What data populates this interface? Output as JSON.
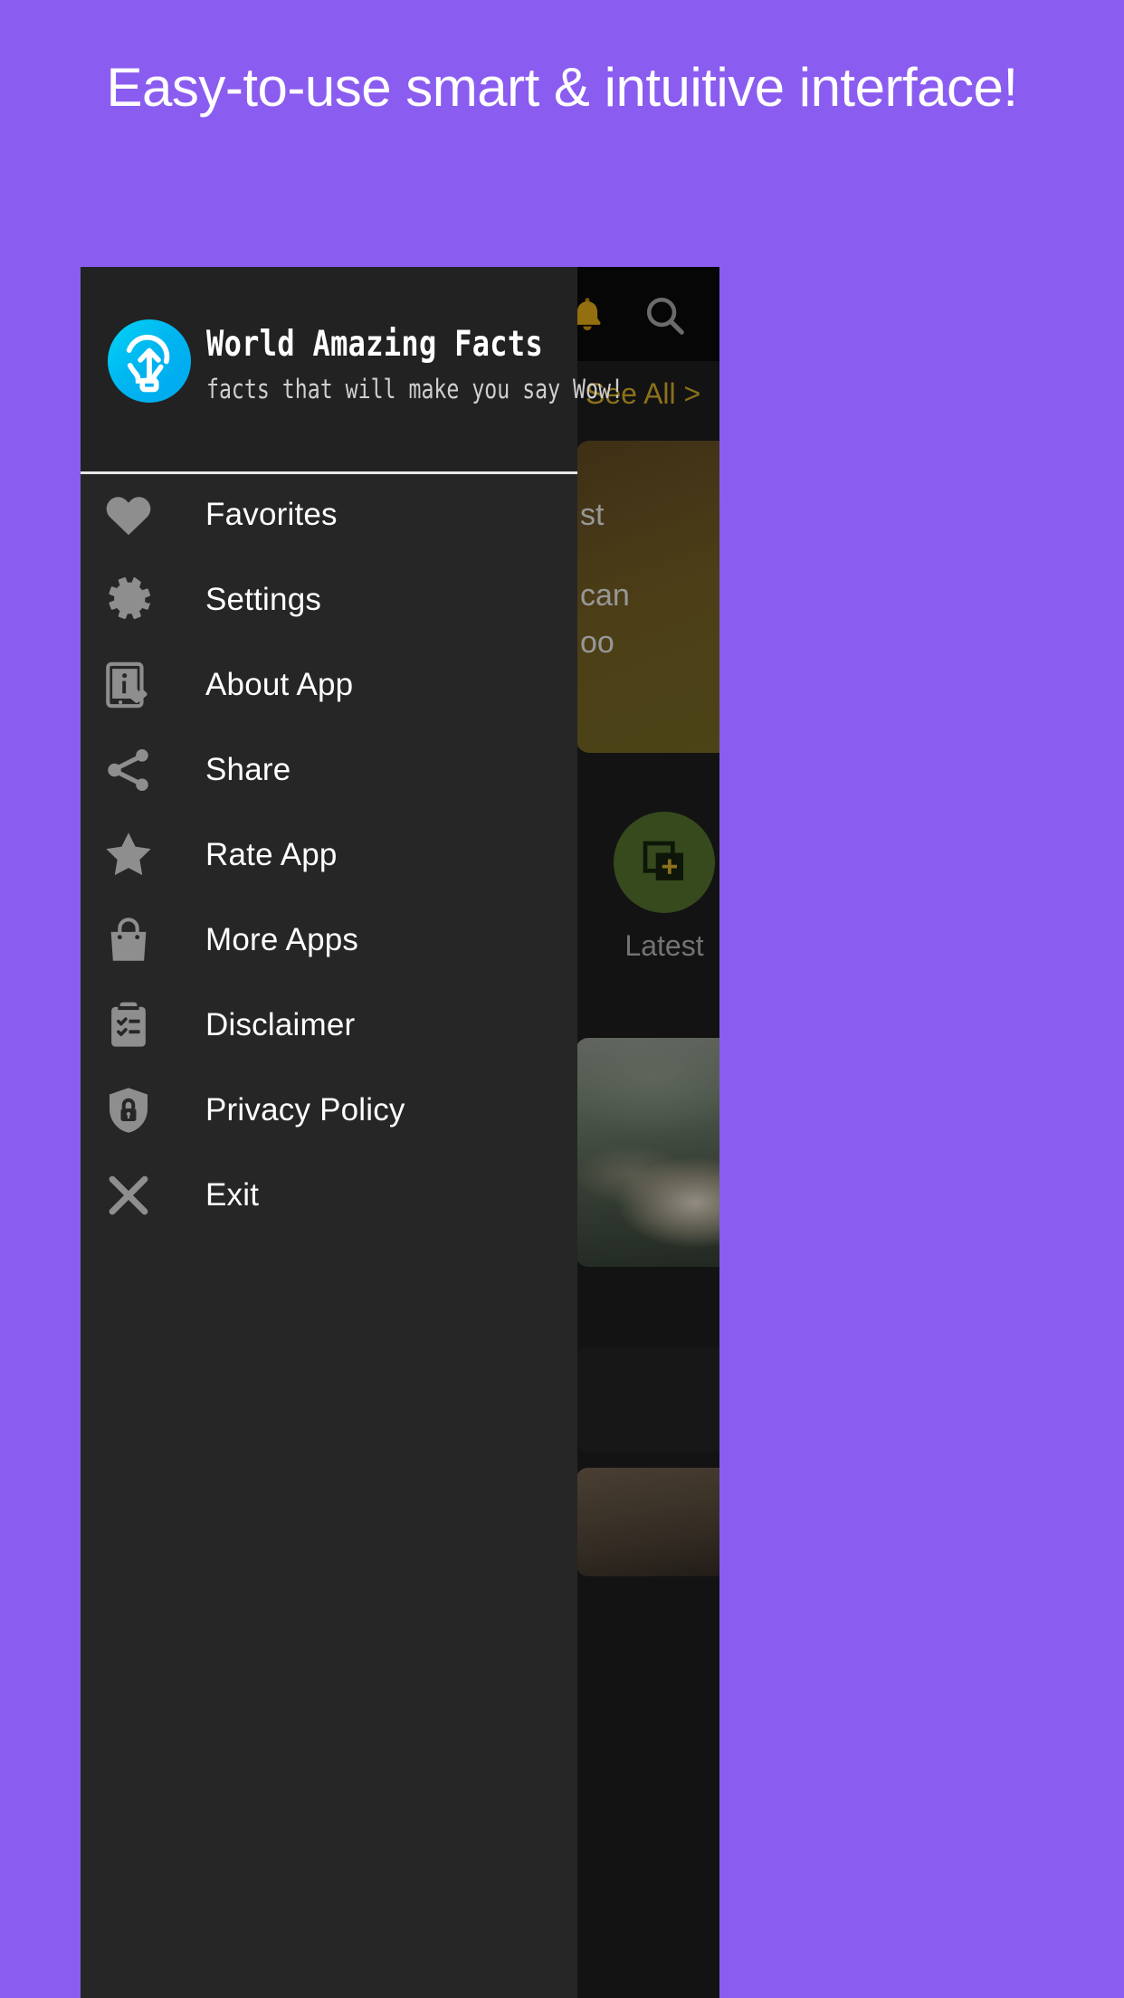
{
  "promo": {
    "headline": "Easy-to-use smart & intuitive interface!",
    "background_color": "#8b5cf0"
  },
  "app": {
    "drawer": {
      "header": {
        "logo_icon": "lightbulb-arrow-icon",
        "title": "World Amazing Facts",
        "subtitle": "facts that will make you say Wow!"
      },
      "items": [
        {
          "label": "Favorites",
          "icon": "heart-icon"
        },
        {
          "label": "Settings",
          "icon": "gear-icon"
        },
        {
          "label": "About App",
          "icon": "about-app-icon"
        },
        {
          "label": "Share",
          "icon": "share-icon"
        },
        {
          "label": "Rate App",
          "icon": "star-icon"
        },
        {
          "label": "More Apps",
          "icon": "shopping-bag-icon"
        },
        {
          "label": "Disclaimer",
          "icon": "clipboard-checklist-icon"
        },
        {
          "label": "Privacy Policy",
          "icon": "shield-lock-icon"
        },
        {
          "label": "Exit",
          "icon": "close-x-icon"
        }
      ]
    },
    "background": {
      "topbar": {
        "notification_icon": "bell-icon",
        "search_icon": "search-icon"
      },
      "see_all": "See All >",
      "fact_card_lines": [
        "st",
        "can",
        "oo"
      ],
      "category": {
        "label": "Latest",
        "icon": "add-layers-icon",
        "circle_color": "#4e6b2a"
      }
    },
    "colors": {
      "drawer_bg": "#262626",
      "drawer_header_bg": "#222222",
      "topbar_bg": "#0a0a0a",
      "accent_gold": "#c9a227",
      "icon_gray": "#8e8e8e"
    }
  }
}
